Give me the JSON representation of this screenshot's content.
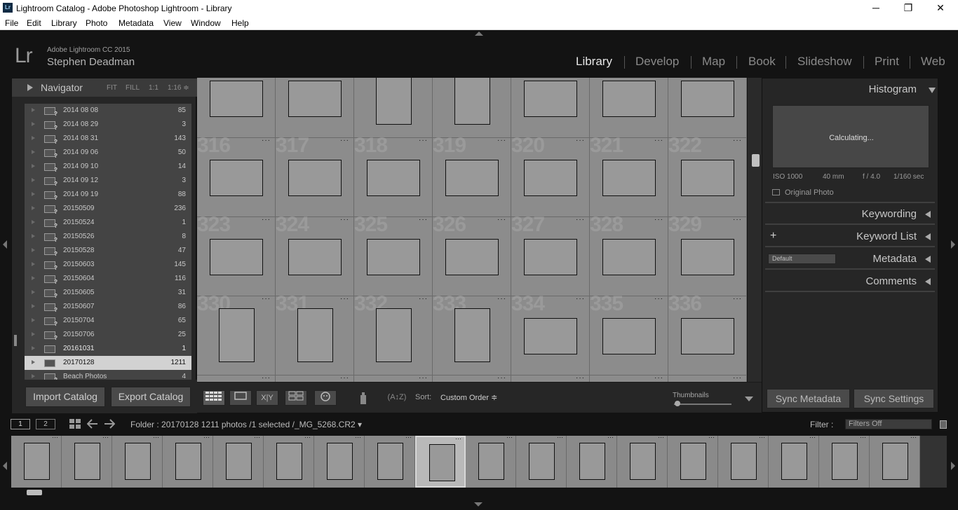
{
  "window": {
    "title": "Lightroom Catalog - Adobe Photoshop Lightroom - Library",
    "app_icon": "Lr",
    "minimize": "─",
    "maximize": "❐",
    "close": "✕"
  },
  "menu": [
    "File",
    "Edit",
    "Library",
    "Photo",
    "Metadata",
    "View",
    "Window",
    "Help"
  ],
  "identity": {
    "logo": "Lr",
    "product": "Adobe Lightroom CC 2015",
    "user": "Stephen Deadman"
  },
  "modules": [
    "Library",
    "Develop",
    "Map",
    "Book",
    "Slideshow",
    "Print",
    "Web"
  ],
  "active_module": "Library",
  "navigator": {
    "title": "Navigator",
    "options": [
      "FIT",
      "FILL",
      "1:1",
      "1:16 ≑"
    ]
  },
  "folders": [
    {
      "name": "2014 08 08",
      "count": "85",
      "missing": true
    },
    {
      "name": "2014 08 29",
      "count": "3",
      "missing": true
    },
    {
      "name": "2014 08 31",
      "count": "143",
      "missing": true
    },
    {
      "name": "2014 09 06",
      "count": "50",
      "missing": true
    },
    {
      "name": "2014 09 10",
      "count": "14",
      "missing": true
    },
    {
      "name": "2014 09 12",
      "count": "3",
      "missing": true
    },
    {
      "name": "2014 09 19",
      "count": "88",
      "missing": true
    },
    {
      "name": "20150509",
      "count": "236",
      "missing": true
    },
    {
      "name": "20150524",
      "count": "1",
      "missing": true
    },
    {
      "name": "20150526",
      "count": "8",
      "missing": true
    },
    {
      "name": "20150528",
      "count": "47",
      "missing": true
    },
    {
      "name": "20150603",
      "count": "145",
      "missing": true
    },
    {
      "name": "20150604",
      "count": "116",
      "missing": true
    },
    {
      "name": "20150605",
      "count": "31",
      "missing": true
    },
    {
      "name": "20150607",
      "count": "86",
      "missing": true
    },
    {
      "name": "20150704",
      "count": "65",
      "missing": true
    },
    {
      "name": "20150706",
      "count": "25",
      "missing": true
    },
    {
      "name": "20161031",
      "count": "1",
      "missing": false,
      "bold": true
    },
    {
      "name": "20170128",
      "count": "1211",
      "missing": false,
      "selected": true
    },
    {
      "name": "Beach Photos",
      "count": "4",
      "missing": true
    }
  ],
  "left_buttons": {
    "import": "Import Catalog",
    "export": "Export Catalog"
  },
  "grid": {
    "rows": [
      {
        "cells": [
          {
            "num": "",
            "orient": "l"
          },
          {
            "num": "",
            "orient": "l"
          },
          {
            "num": "",
            "orient": "p"
          },
          {
            "num": "",
            "orient": "p"
          },
          {
            "num": "",
            "orient": "l"
          },
          {
            "num": "",
            "orient": "l"
          },
          {
            "num": "",
            "orient": "l"
          }
        ]
      },
      {
        "cells": [
          {
            "num": "316",
            "orient": "l"
          },
          {
            "num": "317",
            "orient": "l"
          },
          {
            "num": "318",
            "orient": "l"
          },
          {
            "num": "319",
            "orient": "l"
          },
          {
            "num": "320",
            "orient": "l"
          },
          {
            "num": "321",
            "orient": "l"
          },
          {
            "num": "322",
            "orient": "l"
          }
        ]
      },
      {
        "cells": [
          {
            "num": "323",
            "orient": "l"
          },
          {
            "num": "324",
            "orient": "l"
          },
          {
            "num": "325",
            "orient": "l"
          },
          {
            "num": "326",
            "orient": "l"
          },
          {
            "num": "327",
            "orient": "l"
          },
          {
            "num": "328",
            "orient": "l"
          },
          {
            "num": "329",
            "orient": "l"
          }
        ]
      },
      {
        "cells": [
          {
            "num": "330",
            "orient": "p"
          },
          {
            "num": "331",
            "orient": "p"
          },
          {
            "num": "332",
            "orient": "p"
          },
          {
            "num": "333",
            "orient": "p"
          },
          {
            "num": "334",
            "orient": "l"
          },
          {
            "num": "335",
            "orient": "l"
          },
          {
            "num": "336",
            "orient": "l"
          }
        ]
      }
    ],
    "dots": "···"
  },
  "toolbar": {
    "sort_label": "Sort:",
    "sort_value": "Custom Order ≑",
    "thumbnails_label": "Thumbnails",
    "xy_label": "X|Y",
    "az_label": "(A↕Z)"
  },
  "right": {
    "histogram": "Histogram",
    "calculating": "Calculating...",
    "exif": {
      "iso": "ISO 1000",
      "focal": "40 mm",
      "aperture": "f / 4.0",
      "shutter": "1/160 sec"
    },
    "original_photo": "Original Photo",
    "keywording": "Keywording",
    "keyword_list": "Keyword List",
    "keyword_add": "+",
    "metadata": "Metadata",
    "metadata_preset": "Default",
    "comments": "Comments",
    "sync_metadata": "Sync Metadata",
    "sync_settings": "Sync Settings"
  },
  "filmbar": {
    "screen1": "1",
    "screen2": "2",
    "info": "Folder : 20170128     1211 photos /1 selected /_MG_5268.CR2 ▾",
    "filter_label": "Filter :",
    "filter_value": "Filters Off"
  },
  "filmstrip": {
    "count": 18,
    "selected_index": 8
  }
}
